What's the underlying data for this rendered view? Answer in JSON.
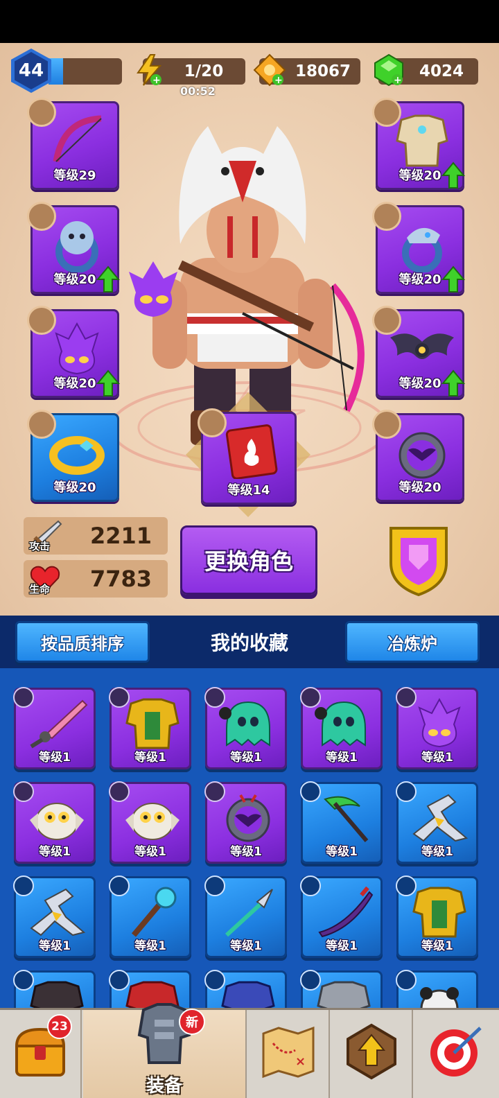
{
  "player": {
    "level": "44",
    "xp_fraction": 0.2
  },
  "resources": {
    "energy": {
      "value": "1/20",
      "timer": "00:52",
      "icon": "lightning-icon",
      "color": "#f5c021"
    },
    "gold": {
      "value": "18067",
      "icon": "gold-ticket-icon",
      "color": "#f5a623"
    },
    "gems": {
      "value": "4024",
      "icon": "green-gem-icon",
      "color": "#3fd12a"
    }
  },
  "equipment": {
    "left_slots": [
      {
        "item": "bow",
        "level": "等级29",
        "upgrade": false,
        "rarity": "epic"
      },
      {
        "item": "lion-ring",
        "level": "等级20",
        "upgrade": true,
        "rarity": "epic"
      },
      {
        "item": "purple-spirit-pet",
        "level": "等级20",
        "upgrade": true,
        "rarity": "epic"
      },
      {
        "item": "gold-ring",
        "level": "等级20",
        "upgrade": false,
        "rarity": "rare"
      }
    ],
    "right_slots": [
      {
        "item": "armor",
        "level": "等级20",
        "upgrade": true,
        "rarity": "epic"
      },
      {
        "item": "dragon-ring",
        "level": "等级20",
        "upgrade": true,
        "rarity": "epic"
      },
      {
        "item": "bat-pet",
        "level": "等级20",
        "upgrade": true,
        "rarity": "epic"
      },
      {
        "item": "bat-medallion",
        "level": "等级20",
        "upgrade": false,
        "rarity": "epic"
      }
    ],
    "center_slot": {
      "item": "fire-spellbook",
      "level": "等级14",
      "upgrade": false,
      "rarity": "epic"
    }
  },
  "stats": {
    "attack": {
      "label": "攻击",
      "value": "2211",
      "icon": "sword-icon"
    },
    "health": {
      "label": "生命",
      "value": "7783",
      "icon": "heart-icon"
    }
  },
  "change_character_label": "更换角色",
  "collection_tabs": {
    "sort_label": "按品质排序",
    "title": "我的收藏",
    "forge_label": "冶炼炉"
  },
  "collection": [
    {
      "item": "pink-sword",
      "level": "等级1",
      "rarity": "epic",
      "type": "weapon"
    },
    {
      "item": "gold-armor",
      "level": "等级1",
      "rarity": "epic",
      "type": "armor"
    },
    {
      "item": "green-ghost",
      "level": "等级1",
      "rarity": "epic",
      "type": "pet"
    },
    {
      "item": "green-ghost",
      "level": "等级1",
      "rarity": "epic",
      "type": "pet"
    },
    {
      "item": "purple-spirit",
      "level": "等级1",
      "rarity": "epic",
      "type": "pet"
    },
    {
      "item": "owl",
      "level": "等级1",
      "rarity": "epic",
      "type": "pet"
    },
    {
      "item": "owl",
      "level": "等级1",
      "rarity": "epic",
      "type": "pet"
    },
    {
      "item": "bat-medallion",
      "level": "等级1",
      "rarity": "epic",
      "type": "amulet"
    },
    {
      "item": "scythe",
      "level": "等级1",
      "rarity": "rare",
      "type": "weapon"
    },
    {
      "item": "boomerang",
      "level": "等级1",
      "rarity": "rare",
      "type": "weapon"
    },
    {
      "item": "boomerang",
      "level": "等级1",
      "rarity": "rare",
      "type": "weapon"
    },
    {
      "item": "staff",
      "level": "等级1",
      "rarity": "rare",
      "type": "weapon"
    },
    {
      "item": "spear",
      "level": "等级1",
      "rarity": "rare",
      "type": "weapon"
    },
    {
      "item": "katana",
      "level": "等级1",
      "rarity": "rare",
      "type": "weapon"
    },
    {
      "item": "gold-armor",
      "level": "等级1",
      "rarity": "rare",
      "type": "armor"
    },
    {
      "item": "dark-armor",
      "level": "",
      "rarity": "rare",
      "type": "armor"
    },
    {
      "item": "red-armor",
      "level": "",
      "rarity": "rare",
      "type": "armor"
    },
    {
      "item": "blue-armor",
      "level": "",
      "rarity": "rare",
      "type": "armor"
    },
    {
      "item": "grey-armor",
      "level": "",
      "rarity": "rare",
      "type": "armor"
    },
    {
      "item": "panda-ring",
      "level": "",
      "rarity": "rare",
      "type": "ring"
    }
  ],
  "nav": {
    "chest": {
      "icon": "treasure-chest-icon",
      "badge": "23"
    },
    "equipment": {
      "icon": "armor-icon",
      "label": "装备",
      "badge": "新"
    },
    "map": {
      "icon": "map-icon"
    },
    "upgrade": {
      "icon": "upgrade-arrow-icon"
    },
    "target": {
      "icon": "target-icon"
    }
  }
}
